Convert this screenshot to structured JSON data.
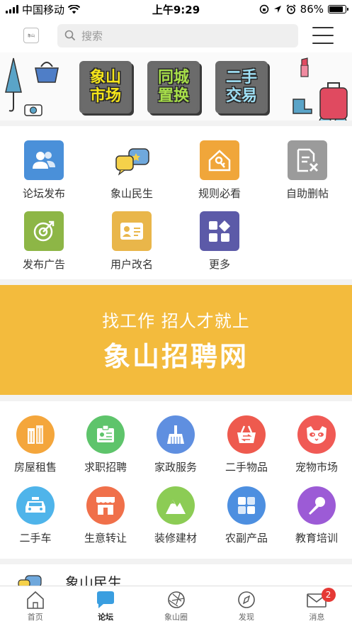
{
  "status_bar": {
    "carrier": "中国移动",
    "time": "上午9:29",
    "battery": "86%",
    "battery_level": 0.86
  },
  "header": {
    "logo_text": "象山",
    "search_placeholder": "搜索"
  },
  "banner": {
    "tiles": [
      {
        "line1": "象山",
        "line2": "市场"
      },
      {
        "line1": "同城",
        "line2": "置换"
      },
      {
        "line1": "二手",
        "line2": "交易"
      }
    ]
  },
  "forum_menu": {
    "items": [
      {
        "label": "论坛发布",
        "icon": "users-icon",
        "color": "#4a90d9"
      },
      {
        "label": "象山民生",
        "icon": "chat-bubbles-icon",
        "color": "#6fa8dc"
      },
      {
        "label": "规则必看",
        "icon": "house-key-icon",
        "color": "#f0a63a"
      },
      {
        "label": "自助删帖",
        "icon": "delete-doc-icon",
        "color": "#9b9b9b"
      },
      {
        "label": "发布广告",
        "icon": "target-icon",
        "color": "#8db646"
      },
      {
        "label": "用户改名",
        "icon": "id-card-icon",
        "color": "#e9b64a"
      },
      {
        "label": "更多",
        "icon": "more-shapes-icon",
        "color": "#5c5aa8"
      }
    ]
  },
  "job_banner": {
    "line1": "找工作 招人才就上",
    "line2": "象山招聘网"
  },
  "category_menu": {
    "items": [
      {
        "label": "房屋租售",
        "icon": "building-icon",
        "color": "#f4a63c"
      },
      {
        "label": "求职招聘",
        "icon": "badge-icon",
        "color": "#5ec46b"
      },
      {
        "label": "家政服务",
        "icon": "broom-icon",
        "color": "#5f8fe0"
      },
      {
        "label": "二手物品",
        "icon": "basket-icon",
        "color": "#ee5a4e"
      },
      {
        "label": "宠物市场",
        "icon": "cat-icon",
        "color": "#f05a55"
      },
      {
        "label": "二手车",
        "icon": "car-icon",
        "color": "#4fb4ea"
      },
      {
        "label": "生意转让",
        "icon": "shop-icon",
        "color": "#f0704a"
      },
      {
        "label": "装修建材",
        "icon": "mountain-icon",
        "color": "#8ccc55"
      },
      {
        "label": "农副产品",
        "icon": "blocks-icon",
        "color": "#4d8fe0"
      },
      {
        "label": "教育培训",
        "icon": "microphone-icon",
        "color": "#9c5bd6"
      }
    ]
  },
  "news": {
    "title": "象山民生"
  },
  "tabbar": {
    "tabs": [
      {
        "label": "首页",
        "icon": "home-icon"
      },
      {
        "label": "论坛",
        "icon": "forum-chat-icon",
        "active": true
      },
      {
        "label": "象山圈",
        "icon": "aperture-icon"
      },
      {
        "label": "发现",
        "icon": "compass-icon"
      },
      {
        "label": "消息",
        "icon": "mail-icon",
        "badge": "2"
      }
    ]
  }
}
